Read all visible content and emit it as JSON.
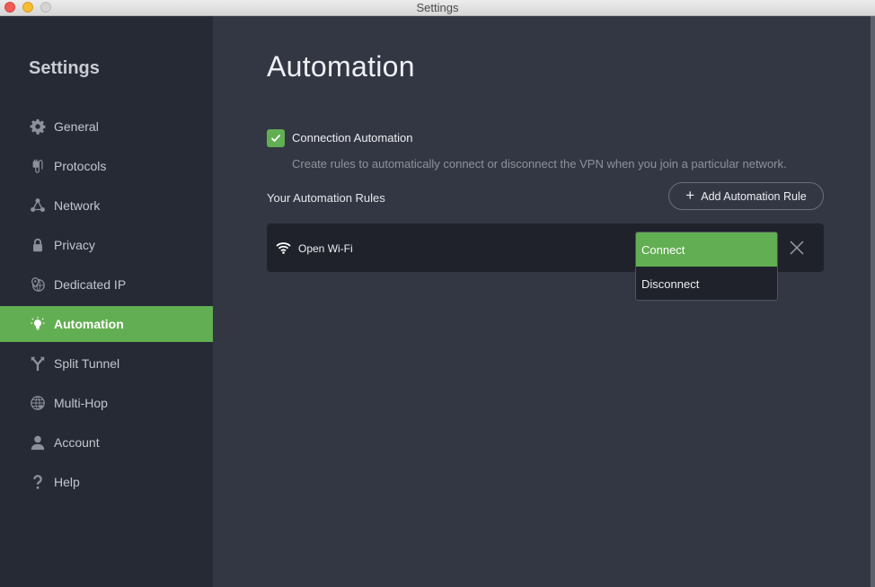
{
  "window": {
    "title": "Settings"
  },
  "sidebar": {
    "title": "Settings",
    "items": [
      {
        "label": "General",
        "icon": "gear-icon",
        "active": false
      },
      {
        "label": "Protocols",
        "icon": "plug-icon",
        "active": false
      },
      {
        "label": "Network",
        "icon": "network-icon",
        "active": false
      },
      {
        "label": "Privacy",
        "icon": "lock-icon",
        "active": false
      },
      {
        "label": "Dedicated IP",
        "icon": "dedicated-ip-icon",
        "active": false
      },
      {
        "label": "Automation",
        "icon": "lightbulb-icon",
        "active": true
      },
      {
        "label": "Split Tunnel",
        "icon": "split-tunnel-icon",
        "active": false
      },
      {
        "label": "Multi-Hop",
        "icon": "globe-icon",
        "active": false
      },
      {
        "label": "Account",
        "icon": "user-icon",
        "active": false
      },
      {
        "label": "Help",
        "icon": "question-icon",
        "active": false
      }
    ]
  },
  "main": {
    "title": "Automation",
    "connection_automation": {
      "label": "Connection Automation",
      "checked": true,
      "description": "Create rules to automatically connect or disconnect the VPN when you join a particular network."
    },
    "rules_heading": "Your Automation Rules",
    "add_rule_label": "Add Automation Rule",
    "rules": [
      {
        "network": "Open Wi-Fi",
        "icon": "wifi-icon",
        "action_options": [
          "Connect",
          "Disconnect"
        ],
        "selected_action": "Connect"
      }
    ]
  },
  "colors": {
    "accent": "#62ae52",
    "sidebar_bg": "#262a35",
    "main_bg": "#333743",
    "card_bg": "#1f222a"
  }
}
